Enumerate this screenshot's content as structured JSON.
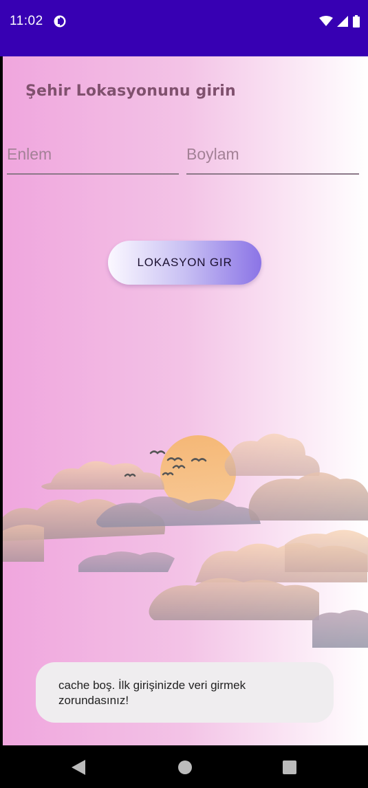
{
  "status_bar": {
    "time": "11:02",
    "bg_color": "#3700b3",
    "icons": [
      "app-notification-icon",
      "wifi-icon",
      "signal-icon",
      "battery-icon"
    ]
  },
  "screen": {
    "title": "Şehir Lokasyonunu girin",
    "latitude_field": {
      "placeholder": "Enlem",
      "value": ""
    },
    "longitude_field": {
      "placeholder": "Boylam",
      "value": ""
    },
    "submit_button": {
      "label": "LOKASYON GIR"
    },
    "illustration": "clouds-sun-birds"
  },
  "toast": {
    "message": "cache boş. İlk girişinizde veri girmek zorundasınız!"
  },
  "nav_bar": {
    "icons": [
      "back-icon",
      "home-icon",
      "recents-icon"
    ]
  }
}
